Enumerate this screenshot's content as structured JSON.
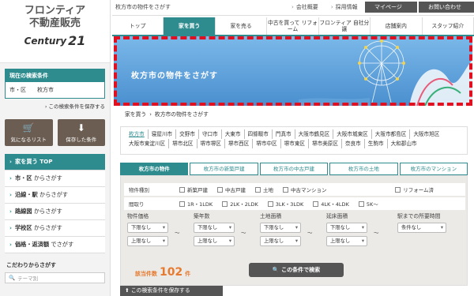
{
  "logo": {
    "line1": "フロンティア",
    "line2": "不動産販売",
    "mark_word": "Century",
    "mark_num": "21"
  },
  "current": {
    "title": "現在の検索条件",
    "label": "市・区",
    "value": "枚方市",
    "save_link": "この検索条件を保存する"
  },
  "icons": [
    {
      "label": "気になるリスト",
      "icon": "cart-icon"
    },
    {
      "label": "保存した条件",
      "icon": "download-icon"
    }
  ],
  "menu": [
    {
      "prefix": "家を買う",
      "suffix": "TOP"
    },
    {
      "prefix": "市・区",
      "suffix": "からさがす"
    },
    {
      "prefix": "沿線・駅",
      "suffix": "からさがす"
    },
    {
      "prefix": "路線図",
      "suffix": "からさがす"
    },
    {
      "prefix": "学校区",
      "suffix": "からさがす"
    },
    {
      "prefix": "価格・返済額",
      "suffix": "でさがす"
    }
  ],
  "kodawari": {
    "title": "こだわりからさがす",
    "placeholder": "テーマ別"
  },
  "topbar": {
    "heading": "枚方市の物件をさがす",
    "links": [
      "会社概要",
      "採用情報"
    ],
    "mypage": "マイページ",
    "contact": "お問い合わせ"
  },
  "nav": [
    "トップ",
    "家を買う",
    "家を売る",
    "中古を買って リフォーム",
    "フロンティア 自社分譲",
    "店舗案内",
    "スタッフ紹介"
  ],
  "hero": {
    "title": "枚方市の物件をさがす"
  },
  "breadcrumb": [
    "家を買う",
    "枚方市の物件をさがす"
  ],
  "areas": {
    "row1": [
      "枚方市",
      "寝屋川市",
      "交野市",
      "守口市",
      "大東市",
      "四條畷市",
      "門真市",
      "大阪市鶴見区",
      "大阪市城東区",
      "大阪市都島区",
      "大阪市旭区"
    ],
    "row2": [
      "大阪市東淀川区",
      "堺市北区",
      "堺市堺区",
      "堺市西区",
      "堺市中区",
      "堺市東区",
      "堺市美原区",
      "奈良市",
      "生駒市",
      "大和郡山市"
    ]
  },
  "search_tabs": [
    "枚方市の物件",
    "枚方市の新築戸建",
    "枚方市の中古戸建",
    "枚方市の土地",
    "枚方市のマンション"
  ],
  "panel": {
    "row1_label": "物件種別",
    "row1_opts": [
      "新築戸建",
      "中古戸建",
      "土地",
      "中古マンション"
    ],
    "row1_right": "リフォーム済",
    "row2_label": "間取り",
    "row2_opts": [
      "1R・1LDK",
      "2LK・2LDK",
      "3LK・3LDK",
      "4LK・4LDK",
      "5K〜"
    ],
    "groups": [
      {
        "title": "物件価格",
        "low": "下限なし",
        "high": "上限なし"
      },
      {
        "title": "築年数",
        "low": "下限なし",
        "high": "上限なし"
      },
      {
        "title": "土地面積",
        "low": "下限なし",
        "high": "上限なし"
      },
      {
        "title": "延床面積",
        "low": "下限なし",
        "high": "上限なし"
      }
    ],
    "station": {
      "title": "駅までの所要時間",
      "value": "条件なし"
    },
    "tilde": "〜",
    "count_prefix": "該当件数",
    "count": "102",
    "count_suffix": "件",
    "search_button": "この条件で検索",
    "save_bar": "この検索条件を保存する"
  }
}
